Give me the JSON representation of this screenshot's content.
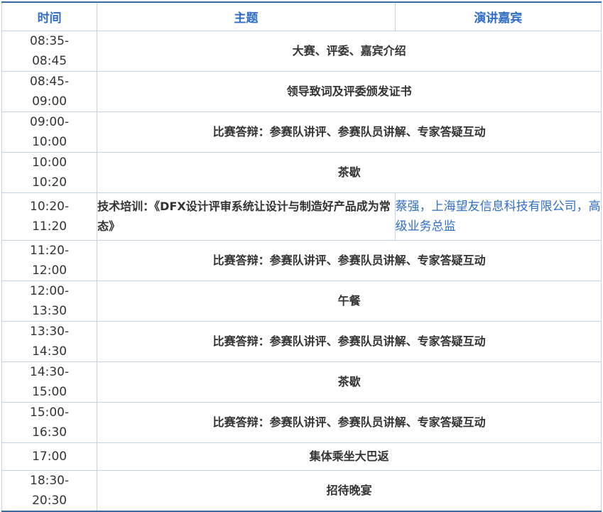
{
  "header": {
    "time": "时间",
    "topic": "主题",
    "speaker": "演讲嘉宾"
  },
  "rows": [
    {
      "time_start": "08:35-",
      "time_end": "08:45",
      "topic": "大赛、评委、嘉宾介绍"
    },
    {
      "time_start": "08:45-",
      "time_end": "09:00",
      "topic": "领导致词及评委颁发证书"
    },
    {
      "time_start": "09:00-",
      "time_end": "10:00",
      "topic": "比赛答辩：参赛队讲评、参赛队员讲解、专家答疑互动"
    },
    {
      "time_start": "10:00",
      "time_end": "10:20",
      "topic": "茶歇"
    },
    {
      "time_start": "10:20-",
      "time_end": "11:20",
      "topic": "技术培训：《DFX设计评审系统让设计与制造好产品成为常态》",
      "speaker": "蔡强，上海望友信息科技有限公司，高级业务总监"
    },
    {
      "time_start": "11:20-",
      "time_end": "12:00",
      "topic": "比赛答辩：参赛队讲评、参赛队员讲解、专家答疑互动"
    },
    {
      "time_start": "12:00-",
      "time_end": "13:30",
      "topic": "午餐"
    },
    {
      "time_start": "13:30-",
      "time_end": "14:30",
      "topic": "比赛答辩：参赛队讲评、参赛队员讲解、专家答疑互动"
    },
    {
      "time_start": "14:30-",
      "time_end": "15:00",
      "topic": "茶歇"
    },
    {
      "time_start": "15:00-",
      "time_end": "16:30",
      "topic": "比赛答辩：参赛队讲评、参赛队员讲解、专家答疑互动"
    },
    {
      "time_start": "17:00",
      "time_end": "",
      "topic": "集体乘坐大巴返"
    },
    {
      "time_start": "18:30-",
      "time_end": "20:30",
      "topic": "招待晚宴"
    }
  ]
}
